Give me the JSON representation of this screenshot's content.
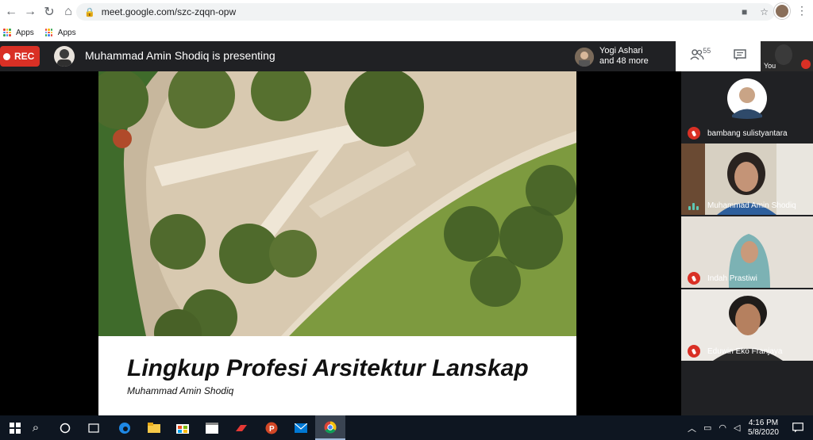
{
  "browser": {
    "url": "meet.google.com/szc-zqqn-opw",
    "bookmarks": [
      "Apps",
      "Apps"
    ]
  },
  "meet": {
    "rec_label": "REC",
    "presenting_text": "Muhammad Amin Shodiq is presenting",
    "others_line1": "Yogi Ashari",
    "others_line2": "and 48 more",
    "participant_count": "55",
    "self_label": "You"
  },
  "slide": {
    "title": "Lingkup Profesi Arsitektur Lanskap",
    "subtitle": "Muhammad Amin Shodiq"
  },
  "participants": [
    {
      "name": "bambang sulistyantara",
      "muted": true
    },
    {
      "name": "Muhammad Amin Shodiq",
      "muted": false
    },
    {
      "name": "Indah Prastiwi",
      "muted": true
    },
    {
      "name": "Eduwin Eko Franjaya",
      "muted": true
    }
  ],
  "taskbar": {
    "time": "4:16 PM",
    "date": "5/8/2020"
  },
  "colors": {
    "rec_red": "#d93025",
    "meet_dark": "#202124",
    "taskbar": "#0e1621"
  }
}
